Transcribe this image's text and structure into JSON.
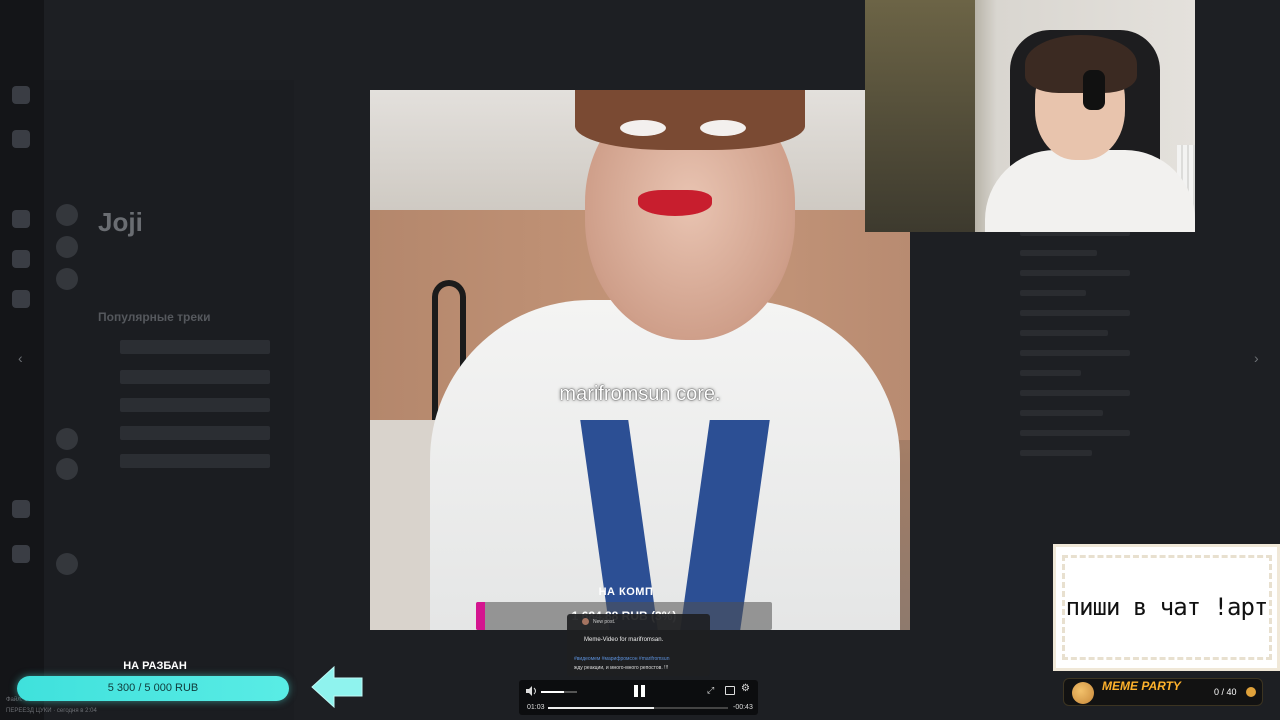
{
  "video": {
    "caption": "marifromsun core.",
    "goal_label": "НА КОМП",
    "goal_text": "1 684,88 RUB (3%)",
    "goal_fraction": 0.03
  },
  "post": {
    "new_post": "New post.",
    "title": "Meme-Video for marifromsan.",
    "hashtags": "#видеомем #марифромсон #marifromsun",
    "body": "жду реакции, и много-много репостов. !!!"
  },
  "player": {
    "current_time": "01:03",
    "remaining_time": "-00:43",
    "progress_fraction": 0.59,
    "volume_fraction": 0.65
  },
  "chat_command": {
    "text": "пиши в чат !арт"
  },
  "meme_party": {
    "title": "MEME PARTY",
    "count": "0 / 40"
  },
  "donation_goal": {
    "label": "НА РАЗБАН",
    "text": "5 300 / 5 000 RUB",
    "accent": "#3fe1dc"
  },
  "background_app": {
    "artist": "Joji",
    "popular_tracks": "Популярные треки",
    "footer_file": "Файл: 1 MB",
    "footer_status": "ПЕРЕЕЗД ЦУКИ · сегодня в 2:04"
  },
  "colors": {
    "goal_fill": "#d4158f",
    "meme_title": "#ffb22c",
    "tie": "#2c4f94"
  }
}
